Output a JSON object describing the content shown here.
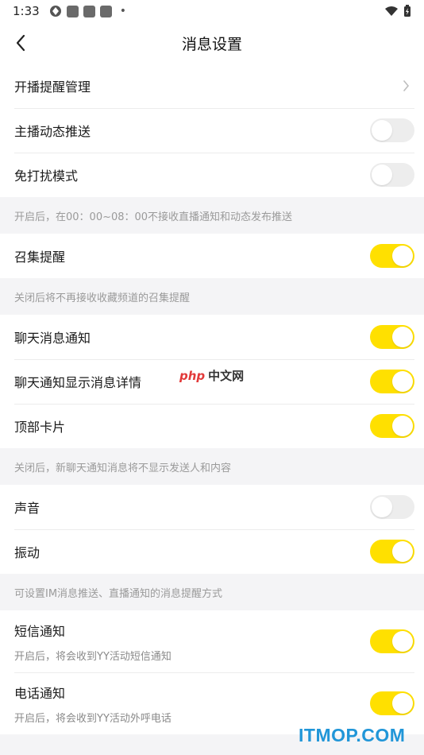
{
  "status_bar": {
    "time": "1:33"
  },
  "nav": {
    "title": "消息设置"
  },
  "group1": {
    "rows": [
      {
        "label": "开播提醒管理"
      },
      {
        "label": "主播动态推送",
        "on": false
      },
      {
        "label": "免打扰模式",
        "on": false
      }
    ],
    "note": "开启后，在00：00~08：00不接收直播通知和动态发布推送"
  },
  "group2": {
    "rows": [
      {
        "label": "召集提醒",
        "on": true
      }
    ],
    "note": "关闭后将不再接收收藏频道的召集提醒"
  },
  "group3": {
    "rows": [
      {
        "label": "聊天消息通知",
        "on": true
      },
      {
        "label": "聊天通知显示消息详情",
        "on": true
      },
      {
        "label": "顶部卡片",
        "on": true
      }
    ],
    "note": "关闭后，新聊天通知消息将不显示发送人和内容"
  },
  "group4": {
    "rows": [
      {
        "label": "声音",
        "on": false
      },
      {
        "label": "振动",
        "on": true
      }
    ],
    "note": "可设置IM消息推送、直播通知的消息提醒方式"
  },
  "group5": {
    "rows": [
      {
        "label": "短信通知",
        "sub": "开启后，将会收到YY活动短信通知",
        "on": true
      },
      {
        "label": "电话通知",
        "sub": "开启后，将会收到YY活动外呼电话",
        "on": true
      }
    ]
  },
  "watermarks": {
    "php": "php",
    "php_cn": "中文网",
    "itmop": "ITMOP.COM"
  },
  "colors": {
    "toggle_on": "#ffe000",
    "toggle_off": "#ededed",
    "background": "#f4f4f6"
  }
}
